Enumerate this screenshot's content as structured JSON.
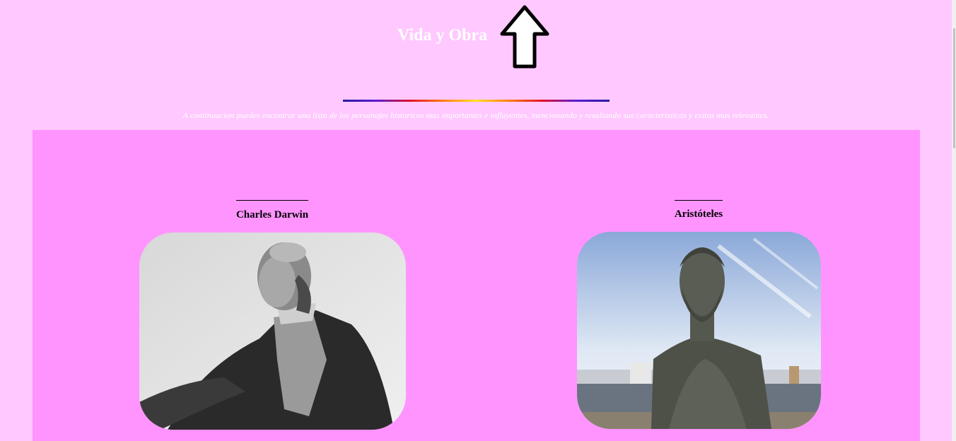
{
  "header": {
    "title": "Vida y Obra",
    "intro": "A continuacion puedes encontrar una lista de los personajes historicos mas importantes e influyentes, mencionando y resaltando sus caracteristicas y exitos mas relevantes.",
    "arrow_icon": "up-arrow-icon"
  },
  "people": [
    {
      "name": "Charles Darwin",
      "image_icon": "portrait-photo-icon"
    },
    {
      "name": "Aristóteles",
      "image_icon": "bust-statue-photo-icon"
    }
  ],
  "colors": {
    "page_background": "#ffc8ff",
    "content_background": "#ff94ff",
    "title_color": "#ffffff"
  }
}
